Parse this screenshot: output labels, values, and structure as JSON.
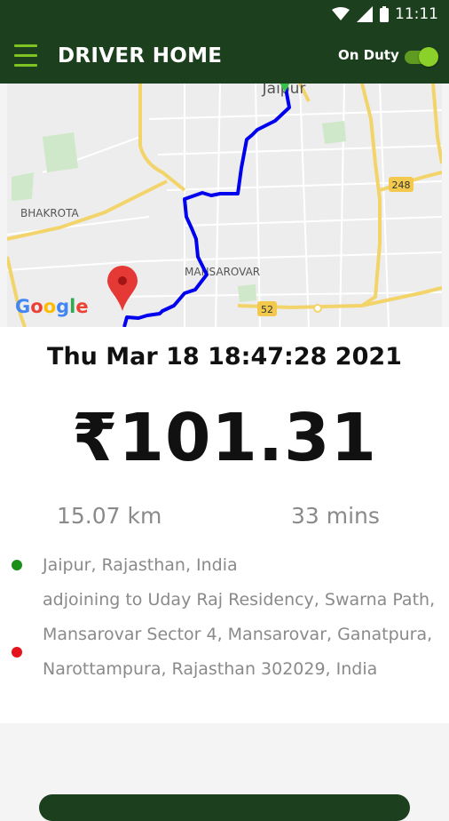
{
  "status_bar": {
    "time": "11:11",
    "icons": [
      "wifi-icon",
      "signal-icon",
      "battery-icon"
    ]
  },
  "app_bar": {
    "title": "DRIVER HOME",
    "duty_label": "On Duty",
    "duty_on": true
  },
  "map": {
    "labels": {
      "city": "Jaipur",
      "area1": "BHAKROTA",
      "area2": "MANSAROVAR",
      "road1": "248",
      "road2": "52"
    },
    "logo": "Google",
    "route_color": "#0000ee"
  },
  "trip": {
    "datetime": "Thu Mar 18 18:47:28 2021",
    "fare": "₹101.31",
    "distance": "15.07 km",
    "duration": "33 mins",
    "from": "Jaipur, Rajasthan, India",
    "to": "adjoining to Uday Raj Residency, Swarna Path, Mansarovar Sector 4, Mansarovar, Ganatpura, Narottampura, Rajasthan 302029, India"
  },
  "colors": {
    "primary": "#1c3f1e",
    "accent": "#7ec322",
    "start": "#1a8f1a",
    "end": "#e5131b"
  }
}
